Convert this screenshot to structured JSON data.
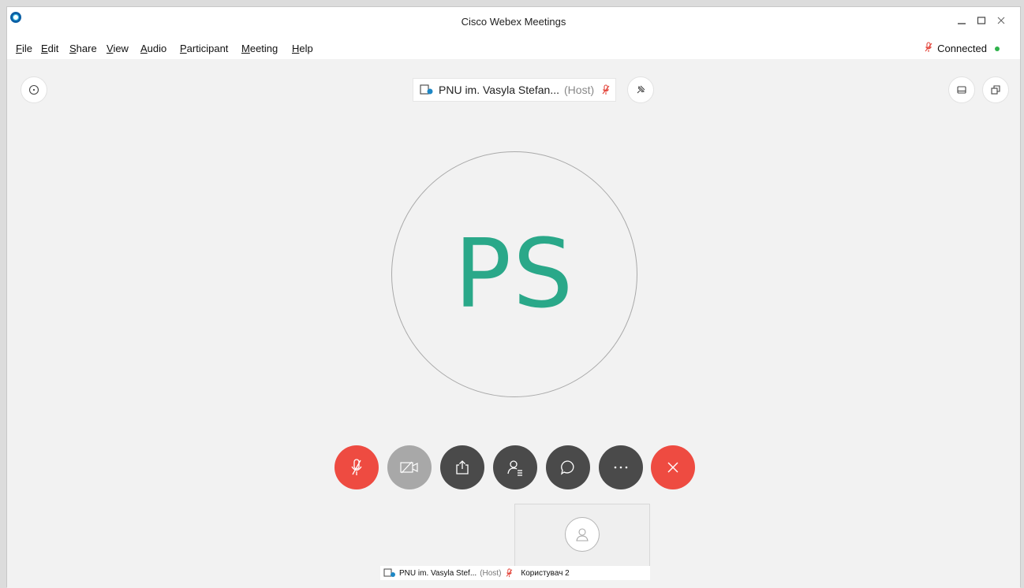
{
  "window": {
    "title": "Cisco Webex Meetings"
  },
  "menu": [
    {
      "key": "F",
      "rest": "ile"
    },
    {
      "key": "E",
      "rest": "dit"
    },
    {
      "key": "S",
      "rest": "hare"
    },
    {
      "key": "V",
      "rest": "iew"
    },
    {
      "key": "A",
      "rest": "udio"
    },
    {
      "key": "P",
      "rest": "articipant"
    },
    {
      "key": "M",
      "rest": "eeting"
    },
    {
      "key": "H",
      "rest": "elp"
    }
  ],
  "status": {
    "label": "Connected",
    "color": "#2fb24b"
  },
  "speaker": {
    "name": "PNU im. Vasyla Stefan...",
    "role": "(Host)"
  },
  "avatar": {
    "initials": "PS",
    "color": "#2aa889"
  },
  "controls": {
    "mute": {
      "color": "#ee4b41"
    },
    "video": {
      "color": "#a8a8a8"
    },
    "share": {
      "color": "#4a4a4a"
    },
    "participants": {
      "color": "#4a4a4a"
    },
    "chat": {
      "color": "#4a4a4a"
    },
    "more": {
      "color": "#4a4a4a"
    },
    "leave": {
      "color": "#ee4b41"
    }
  },
  "thumbnails": {
    "self_name": "PNU im. Vasyla Stef...",
    "self_role": "(Host)",
    "other_name": "Користувач 2"
  }
}
